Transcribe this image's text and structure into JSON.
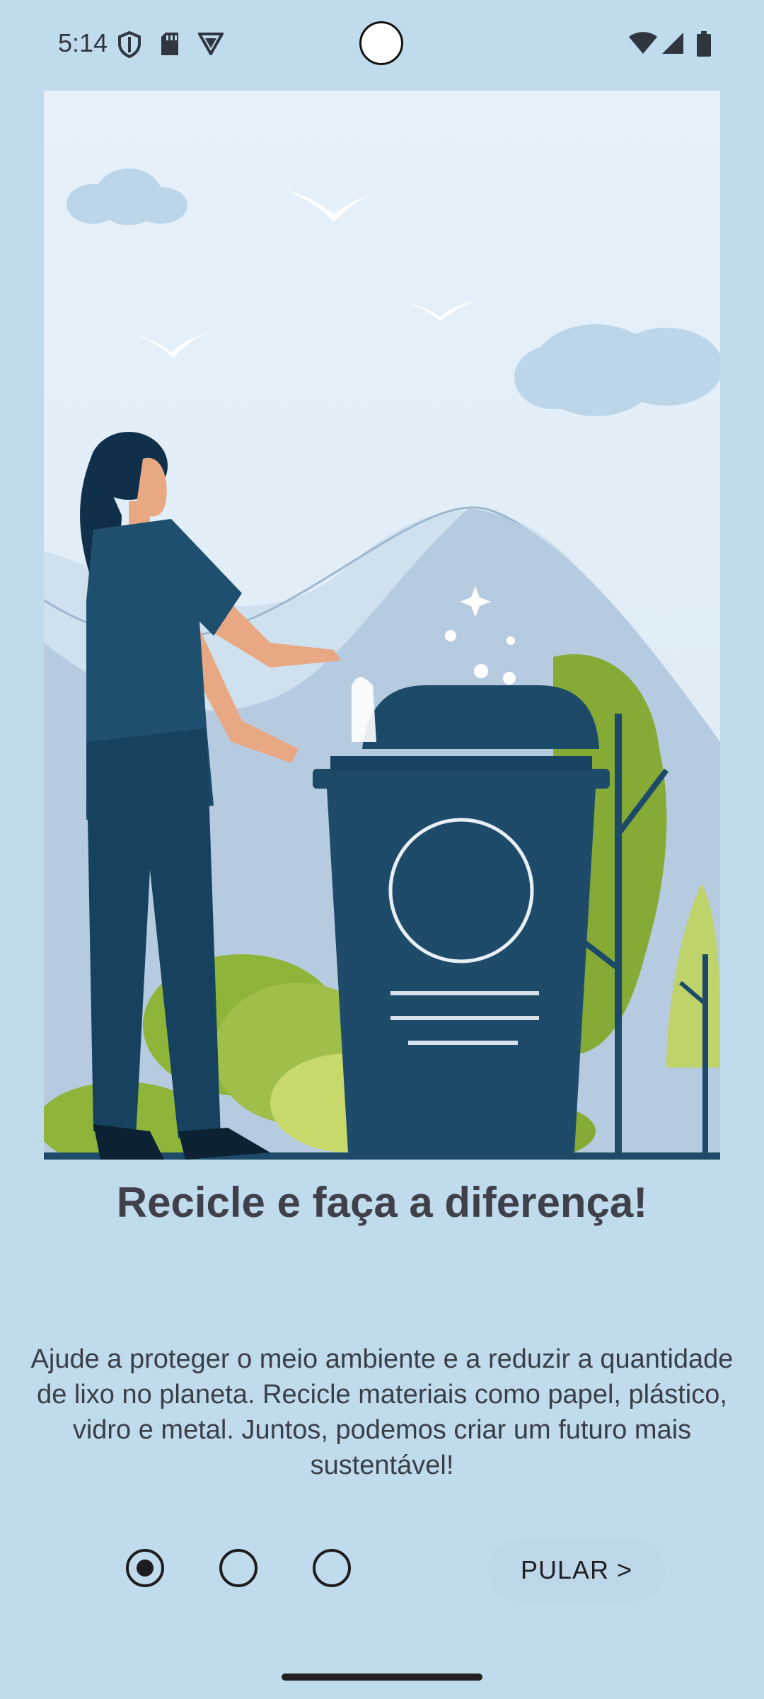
{
  "status_bar": {
    "time": "5:14",
    "left_icons": [
      "shield-icon",
      "sd-card-icon",
      "vpn-badge-icon"
    ],
    "right_icons": [
      "wifi-icon",
      "signal-icon",
      "battery-icon"
    ]
  },
  "illustration": {
    "subject": "recycling-illustration"
  },
  "onboarding": {
    "title": "Recicle e faça a diferença!",
    "description": "Ajude a proteger o meio ambiente e a reduzir a quantidade de lixo no planeta. Recicle materiais como papel, plástico, vidro e metal. Juntos, podemos criar um futuro mais sustentável!",
    "current_page": 1,
    "total_pages": 3,
    "skip_label": "PULAR >"
  },
  "colors": {
    "background": "#c0dbec",
    "bin": "#1d4a68",
    "tree_green": "#8fb43a",
    "title_text": "#40404a"
  }
}
